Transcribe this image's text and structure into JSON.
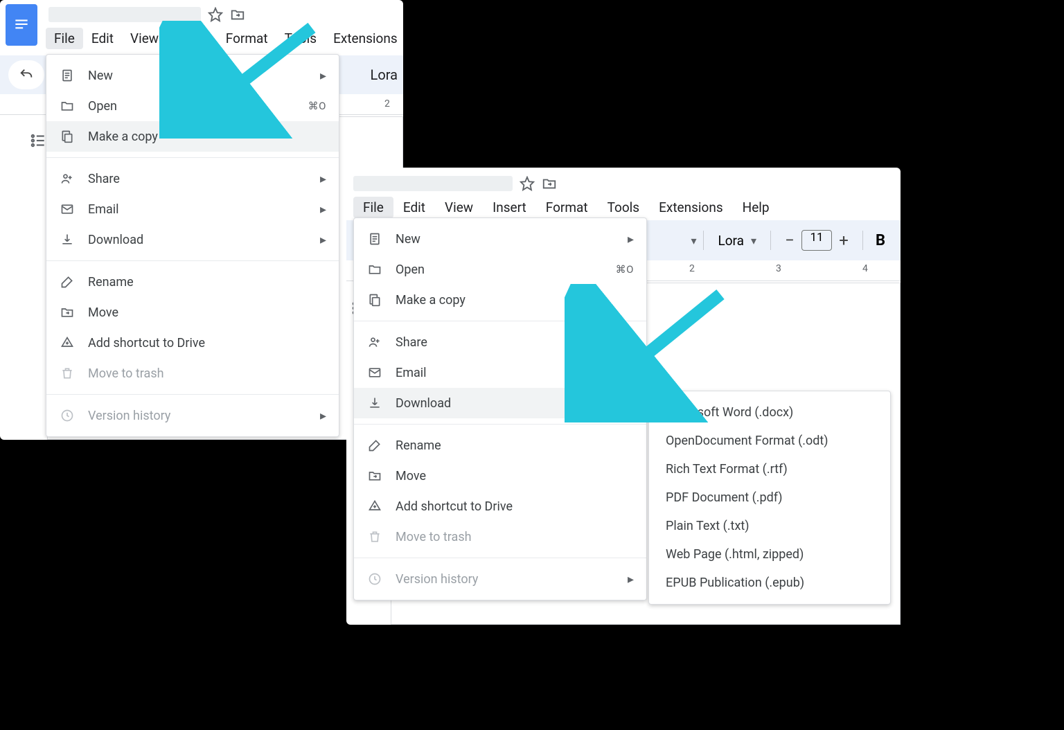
{
  "menubar": {
    "file": "File",
    "edit": "Edit",
    "view": "View",
    "insert": "Insert",
    "format": "Format",
    "tools": "Tools",
    "extensions": "Extensions",
    "help": "Help"
  },
  "toolbar": {
    "font_name": "Lora",
    "font_size": "11",
    "bold": "B"
  },
  "ruler": {
    "p1_tick2": "2",
    "p2_tick2": "2",
    "p2_tick3": "3",
    "p2_tick4": "4"
  },
  "file_menu": {
    "new": "New",
    "open": "Open",
    "open_shortcut": "⌘O",
    "make_copy": "Make a copy",
    "share": "Share",
    "email": "Email",
    "download": "Download",
    "rename": "Rename",
    "move": "Move",
    "add_shortcut": "Add shortcut to Drive",
    "move_to_trash": "Move to trash",
    "version_history": "Version history"
  },
  "download_submenu": {
    "docx": "Microsoft Word (.docx)",
    "odt": "OpenDocument Format (.odt)",
    "rtf": "Rich Text Format (.rtf)",
    "pdf": "PDF Document (.pdf)",
    "txt": "Plain Text (.txt)",
    "html": "Web Page (.html, zipped)",
    "epub": "EPUB Publication (.epub)"
  }
}
